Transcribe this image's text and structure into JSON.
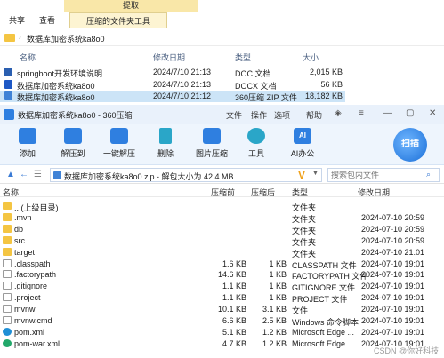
{
  "explorer": {
    "ribbon_context": "提取",
    "tabs": [
      "共享",
      "查看",
      "压缩的文件夹工具"
    ],
    "breadcrumb": "数据库加密系统ka8o0",
    "columns": [
      "名称",
      "修改日期",
      "类型",
      "大小"
    ],
    "files": [
      {
        "name": "springboot开发环境说明",
        "date": "2024/7/10 21:13",
        "type": "DOC 文档",
        "size": "2,015 KB"
      },
      {
        "name": "数据库加密系统ka8o0",
        "date": "2024/7/10 21:13",
        "type": "DOCX 文档",
        "size": "56 KB"
      },
      {
        "name": "数据库加密系统ka8o0",
        "date": "2024/7/10 21:12",
        "type": "360压缩 ZIP 文件",
        "size": "18,182 KB"
      }
    ]
  },
  "zip": {
    "title": "数据库加密系统ka8o0 - 360压缩",
    "menus": [
      "文件",
      "操作",
      "选项",
      "帮助"
    ],
    "toolbar": [
      "添加",
      "解压到",
      "一键解压",
      "删除",
      "图片压缩",
      "工具",
      "AI办公"
    ],
    "scan_label": "扫描",
    "path": "数据库加密系统ka8o0.zip - 解包大小为 42.4 MB",
    "search_placeholder": "搜索包内文件",
    "columns": [
      "名称",
      "压缩前",
      "压缩后",
      "类型",
      "修改日期"
    ],
    "rows": [
      {
        "name": ".. (上级目录)",
        "before": "",
        "after": "",
        "type": "文件夹",
        "date": "",
        "icon": "folder"
      },
      {
        "name": ".mvn",
        "before": "",
        "after": "",
        "type": "文件夹",
        "date": "2024-07-10 20:59",
        "icon": "folder"
      },
      {
        "name": "db",
        "before": "",
        "after": "",
        "type": "文件夹",
        "date": "2024-07-10 20:59",
        "icon": "folder"
      },
      {
        "name": "src",
        "before": "",
        "after": "",
        "type": "文件夹",
        "date": "2024-07-10 20:59",
        "icon": "folder"
      },
      {
        "name": "target",
        "before": "",
        "after": "",
        "type": "文件夹",
        "date": "2024-07-10 21:01",
        "icon": "folder"
      },
      {
        "name": ".classpath",
        "before": "1.6 KB",
        "after": "1 KB",
        "type": "CLASSPATH 文件",
        "date": "2024-07-10 19:01",
        "icon": "file"
      },
      {
        "name": ".factorypath",
        "before": "14.6 KB",
        "after": "1 KB",
        "type": "FACTORYPATH 文件",
        "date": "2024-07-10 19:01",
        "icon": "file"
      },
      {
        "name": ".gitignore",
        "before": "1.1 KB",
        "after": "1 KB",
        "type": "GITIGNORE 文件",
        "date": "2024-07-10 19:01",
        "icon": "file"
      },
      {
        "name": ".project",
        "before": "1.1 KB",
        "after": "1 KB",
        "type": "PROJECT 文件",
        "date": "2024-07-10 19:01",
        "icon": "file"
      },
      {
        "name": "mvnw",
        "before": "10.1 KB",
        "after": "3.1 KB",
        "type": "文件",
        "date": "2024-07-10 19:01",
        "icon": "file"
      },
      {
        "name": "mvnw.cmd",
        "before": "6.6 KB",
        "after": "2.5 KB",
        "type": "Windows 命令脚本",
        "date": "2024-07-10 19:01",
        "icon": "file"
      },
      {
        "name": "pom.xml",
        "before": "5.1 KB",
        "after": "1.2 KB",
        "type": "Microsoft Edge ...",
        "date": "2024-07-10 19:01",
        "icon": "edge"
      },
      {
        "name": "pom-war.xml",
        "before": "4.7 KB",
        "after": "1.2 KB",
        "type": "Microsoft Edge ...",
        "date": "2024-07-10 19:01",
        "icon": "edge"
      }
    ],
    "watermark": "CSDN @你好科技"
  },
  "colors": {
    "accent": "#2f7fe0",
    "selection": "#cce4f7",
    "toolbar_bg": "#eef5fd",
    "folder": "#f4c542"
  }
}
